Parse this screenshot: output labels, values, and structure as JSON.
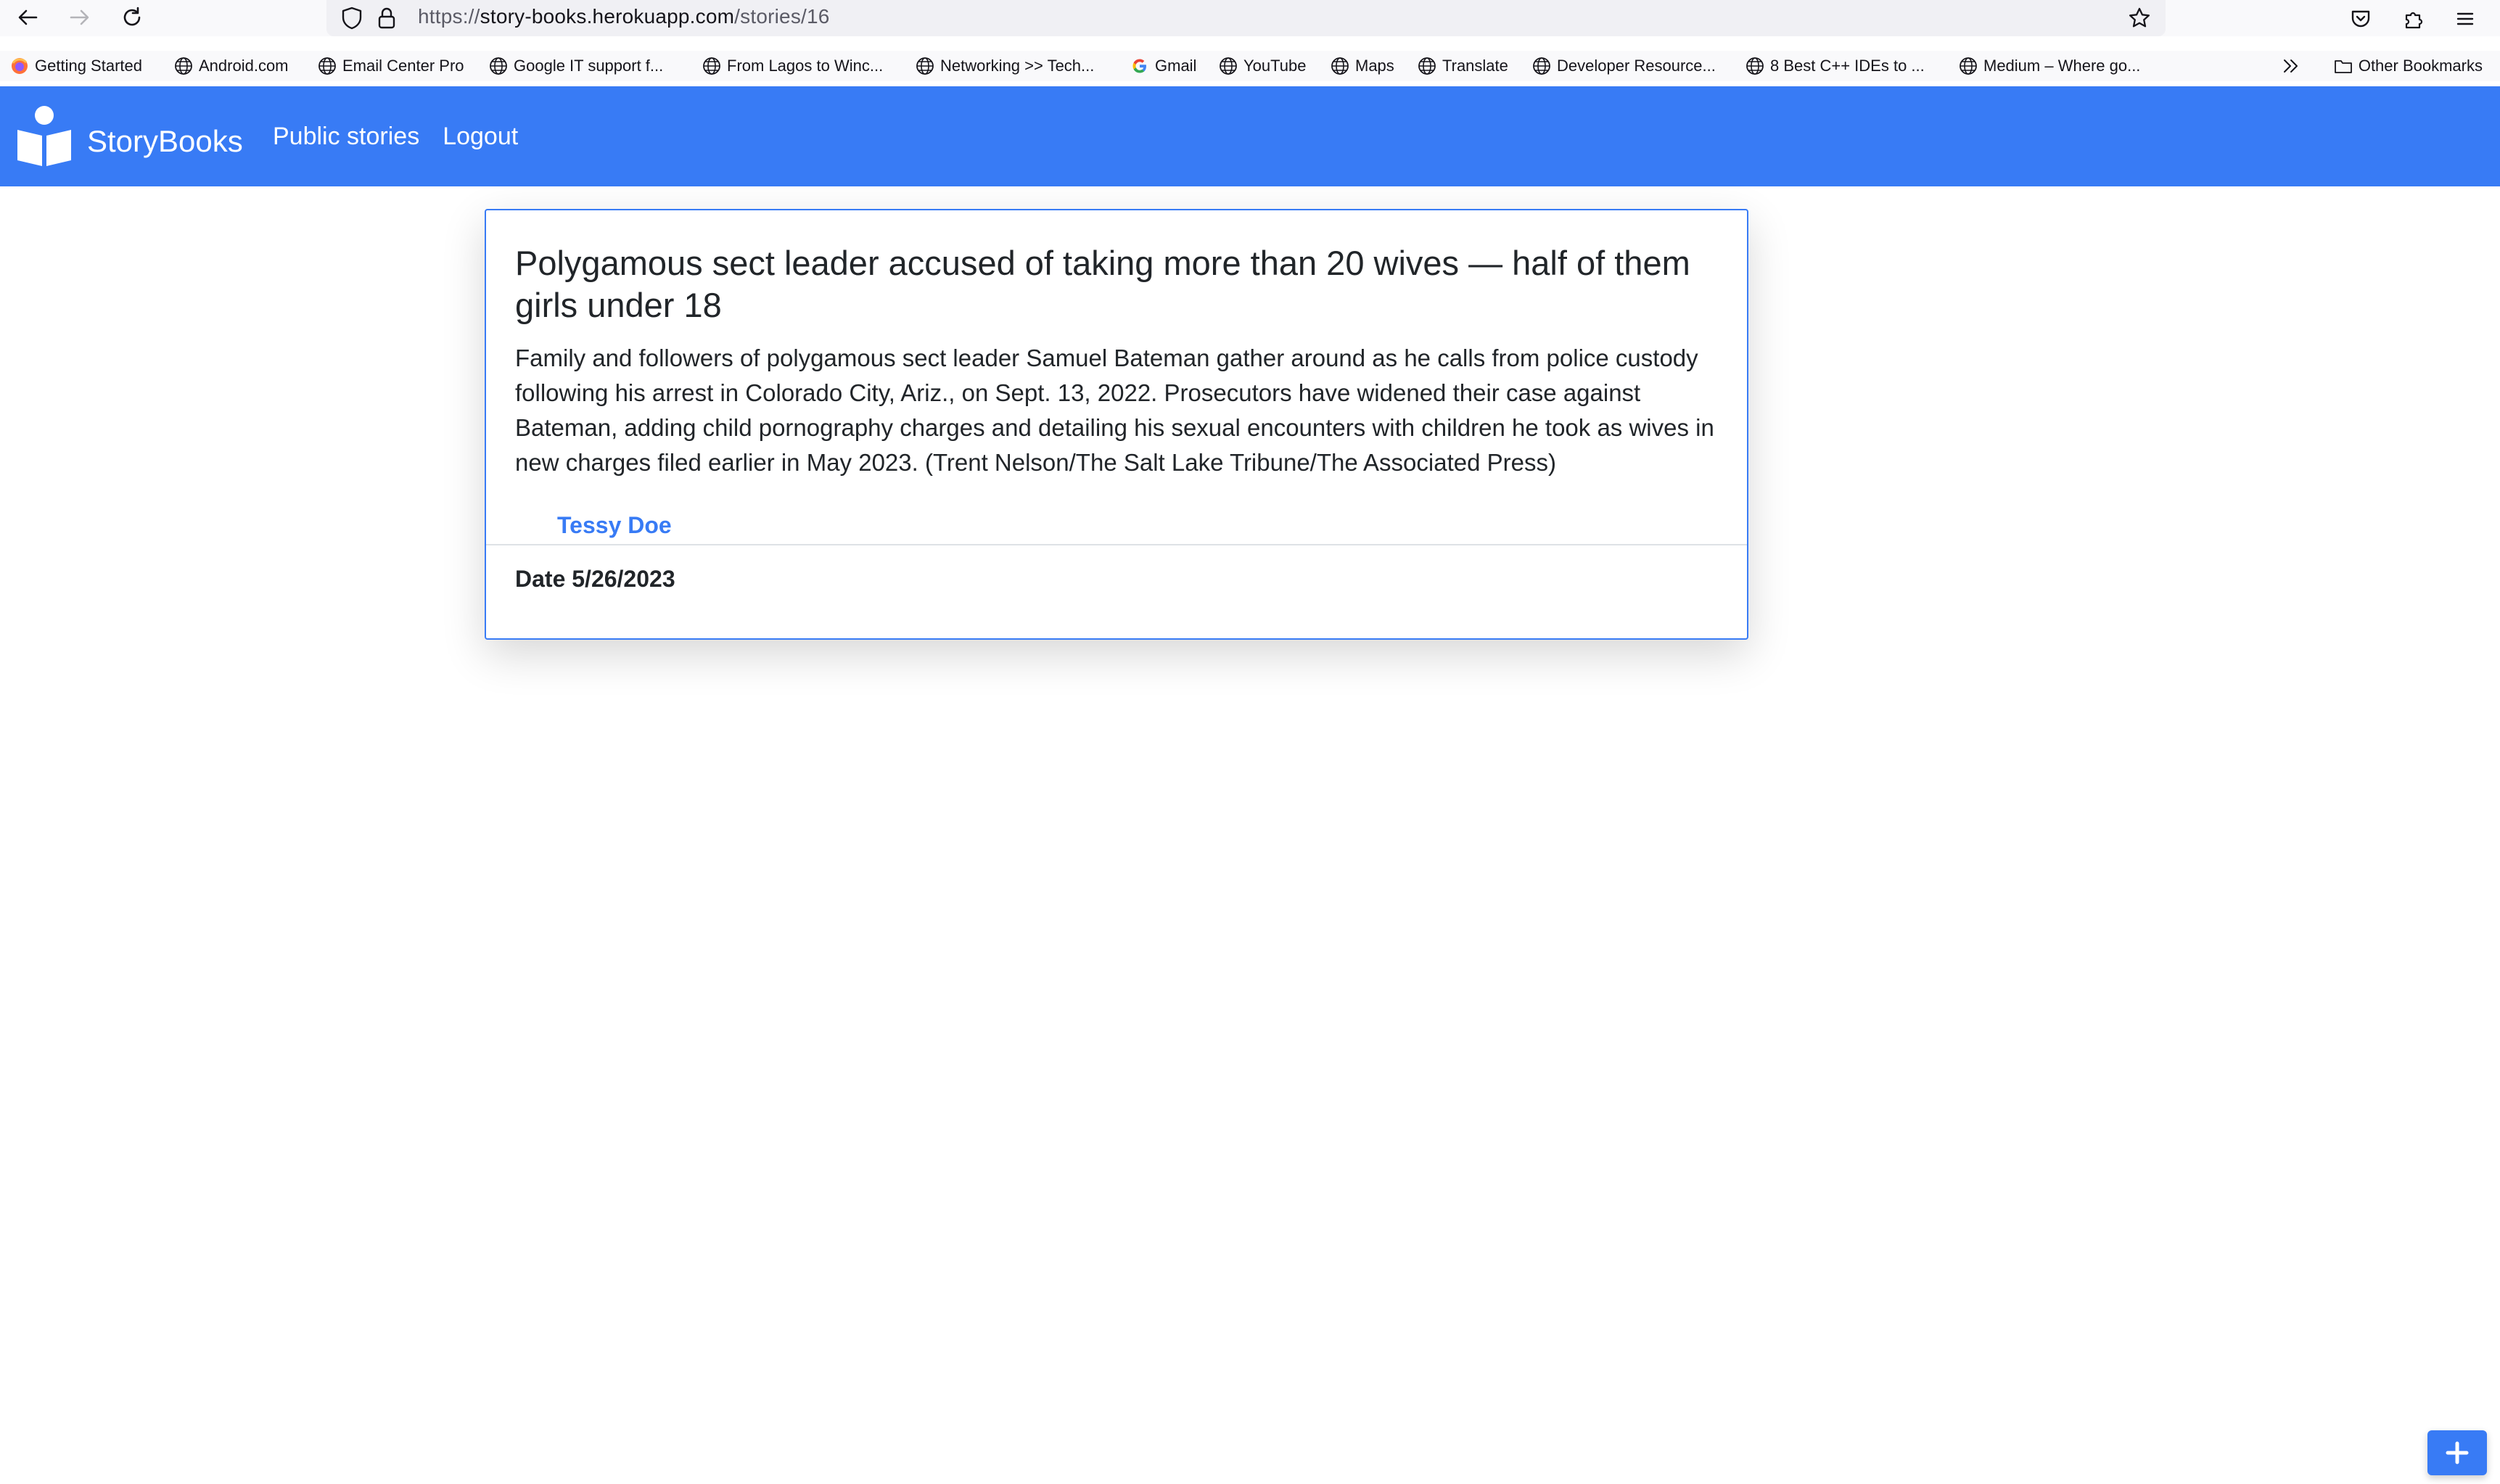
{
  "browser": {
    "url": {
      "scheme": "https://",
      "host": "story-books.herokuapp.com",
      "path": "/stories/16"
    },
    "bookmarks": [
      {
        "label": "Getting Started",
        "icon": "firefox-icon"
      },
      {
        "label": "Android.com",
        "icon": "globe-icon"
      },
      {
        "label": "Email Center Pro",
        "icon": "globe-icon"
      },
      {
        "label": "Google IT support f...",
        "icon": "globe-icon"
      },
      {
        "label": "From Lagos to Winc...",
        "icon": "globe-icon"
      },
      {
        "label": "Networking >> Tech...",
        "icon": "globe-icon"
      },
      {
        "label": "Gmail",
        "icon": "google-icon"
      },
      {
        "label": "YouTube",
        "icon": "globe-icon"
      },
      {
        "label": "Maps",
        "icon": "globe-icon"
      },
      {
        "label": "Translate",
        "icon": "globe-icon"
      },
      {
        "label": "Developer Resource...",
        "icon": "globe-icon"
      },
      {
        "label": "8 Best C++ IDEs to ...",
        "icon": "globe-icon"
      },
      {
        "label": "Medium – Where go...",
        "icon": "globe-icon"
      }
    ],
    "other_bookmarks": "Other Bookmarks"
  },
  "navbar": {
    "brand": "StoryBooks",
    "links": [
      "Public stories",
      "Logout"
    ],
    "color": "#387bf5"
  },
  "story": {
    "title": "Polygamous sect leader accused of taking more than 20 wives — half of them girls under 18",
    "body": "Family and followers of polygamous sect leader Samuel Bateman gather around as he calls from police custody following his arrest in Colorado City, Ariz., on Sept. 13, 2022. Prosecutors have widened their case against Bateman, adding child pornography charges and detailing his sexual encounters with children he took as wives in new charges filed earlier in May 2023. (Trent Nelson/The Salt Lake Tribune/The Associated Press)",
    "author": "Tessy Doe",
    "date": "Date 5/26/2023"
  },
  "fab": {
    "icon": "plus-icon"
  }
}
